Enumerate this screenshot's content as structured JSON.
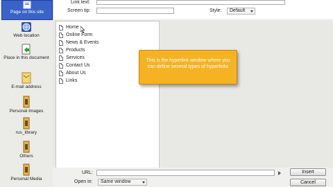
{
  "sidebar": {
    "items": [
      {
        "label": "Page on this site",
        "icon": "page-site-icon",
        "active": true
      },
      {
        "label": "Web location",
        "icon": "globe-icon"
      },
      {
        "label": "Place in this document",
        "icon": "document-place-icon"
      },
      {
        "label": "E-mail address",
        "icon": "email-icon"
      },
      {
        "label": "Personal Images",
        "icon": "folder-icon"
      },
      {
        "label": "rus_library",
        "icon": "folder-icon"
      },
      {
        "label": "Others",
        "icon": "folder-icon"
      },
      {
        "label": "Personal Media",
        "icon": "folder-icon"
      }
    ]
  },
  "form": {
    "link_text_label": "Link text:",
    "screen_tip_label": "Screen tip:",
    "style_label": "Style:",
    "style_value": "Default"
  },
  "tree": {
    "items": [
      "Home",
      "Online Form",
      "News & Events",
      "Products",
      "Services",
      "Contact Us",
      "About Us",
      "Links"
    ]
  },
  "callout": {
    "text": "This is the hyperlink window where you can define several types of hyperlinks"
  },
  "bottom": {
    "url_label": "URL:",
    "open_in_label": "Open in:",
    "open_in_value": "Same window",
    "insert_label": "Insert",
    "cancel_label": "Cancel"
  },
  "colors": {
    "accent": "#3a63c8",
    "callout": "#f5b223"
  }
}
